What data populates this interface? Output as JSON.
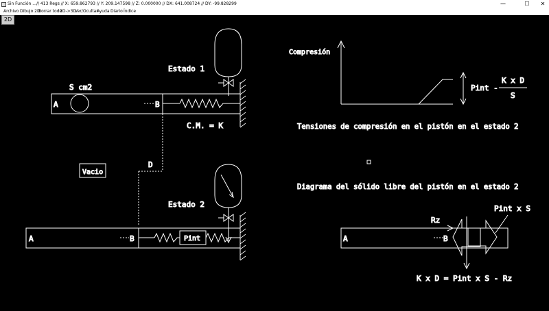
{
  "window": {
    "title": "Sin Función ...// 413 Regs // X: 659.862793 // Y: 209.147598 // Z: 0.000000 // DX: 641.008724 // DY: -99.828299",
    "controls": [
      "—",
      "☐",
      "✕"
    ]
  },
  "menu": {
    "items": [
      "Archivo",
      "Dibujo 2D",
      "Borrar todo",
      "2D->3D",
      "Ver/Ocultar",
      "Ayuda",
      "Diario",
      "Índice"
    ]
  },
  "mode_badge": "2D",
  "drawing": {
    "labels": {
      "estado1": "Estado 1",
      "estado2": "Estado 2",
      "area": "S cm2",
      "a_top": "A",
      "b_top": "B",
      "cm": "C.M. = K",
      "vacio": "Vacio",
      "d": "D",
      "a_bottom": "A",
      "b_bottom": "B",
      "pint": "Pint",
      "compresion": "Compresión",
      "formula_left": "Pint  -",
      "formula_num": "K x D",
      "formula_den": "S",
      "tensiones": "Tensiones de compresión en el pistón en el estado 2",
      "diagrama": "Diagrama del sólido libre del pistón en el estado 2",
      "rz": "Rz",
      "pint_x_s": "Pint x S",
      "a_right": "A",
      "b_right": "B",
      "equation": "K x D = Pint x S - Rz"
    }
  }
}
